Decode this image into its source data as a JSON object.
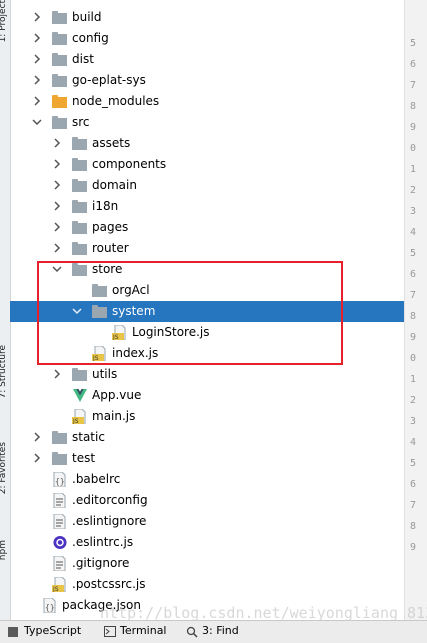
{
  "side_tabs": {
    "project": "1: Project",
    "structure": "7: Structure",
    "favorites": "2: Favorites",
    "npm": "npm"
  },
  "tree": {
    "build": "build",
    "config": "config",
    "dist": "dist",
    "go_eplat_sys": "go-eplat-sys",
    "node_modules": "node_modules",
    "src": "src",
    "assets": "assets",
    "components": "components",
    "domain": "domain",
    "i18n": "i18n",
    "pages": "pages",
    "router": "router",
    "store": "store",
    "orgAcl": "orgAcl",
    "system": "system",
    "login_store": "LoginStore.js",
    "index_js": "index.js",
    "utils": "utils",
    "app_vue": "App.vue",
    "main_js": "main.js",
    "static": "static",
    "test": "test",
    "babelrc": ".babelrc",
    "editorconfig": ".editorconfig",
    "eslintignore": ".eslintignore",
    "eslintrc": ".eslintrc.js",
    "gitignore": ".gitignore",
    "postcssrc": ".postcssrc.js",
    "package_json": "package.json"
  },
  "gutter_numbers": [
    "5",
    "6",
    "7",
    "8",
    "9",
    "0",
    "1",
    "2",
    "3",
    "4",
    "5",
    "6",
    "7",
    "8",
    "9",
    "0",
    "1",
    "2",
    "3",
    "4",
    "5",
    "6",
    "7",
    "8",
    "9"
  ],
  "bottom_tabs": {
    "typescript": "TypeScript",
    "terminal": "Terminal",
    "find": "3: Find"
  },
  "watermark": "http://blog.csdn.net/weiyongliang_813",
  "colors": {
    "selection": "#2675bf",
    "highlight_box": "#e8202a",
    "folder": "#9aa7b0",
    "node_modules_folder": "#f0a732",
    "vue_green": "#41b883"
  }
}
